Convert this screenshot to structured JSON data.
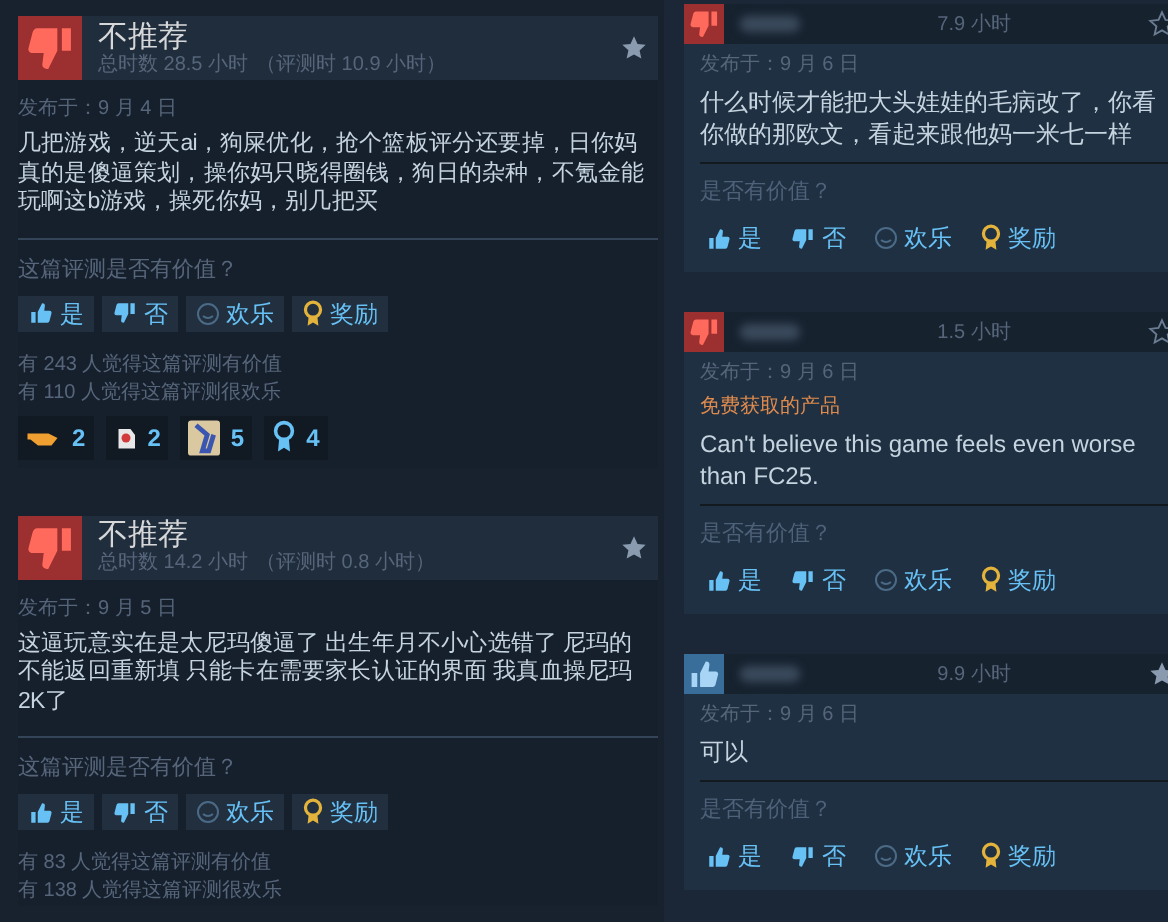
{
  "left_reviews": [
    {
      "recommended": false,
      "title": "不推荐",
      "hours": "总时数 28.5 小时",
      "review_hours": "（评测时 10.9 小时）",
      "date": "发布于：9 月 4 日",
      "text": "几把游戏，逆天ai，狗屎优化，抢个篮板评分还要掉，日你妈真的是傻逼策划，操你妈只晓得圈钱，狗日的杂种，不氪金能玩啊这b游戏，操死你妈，别几把买",
      "question": "这篇评测是否有价值？",
      "buttons": [
        {
          "kind": "yes",
          "label": "是"
        },
        {
          "kind": "no",
          "label": "否"
        },
        {
          "kind": "funny",
          "label": "欢乐"
        },
        {
          "kind": "award",
          "label": "奖励"
        }
      ],
      "helpful": "有 243 人觉得这篇评测有价值",
      "funny": "有 110 人觉得这篇评测很欢乐",
      "awards": [
        {
          "kind": "pointer",
          "count": "2"
        },
        {
          "kind": "tag",
          "count": "2"
        },
        {
          "kind": "figure",
          "count": "5"
        },
        {
          "kind": "ribbon",
          "count": "4"
        }
      ]
    },
    {
      "recommended": false,
      "title": "不推荐",
      "hours": "总时数 14.2 小时",
      "review_hours": "（评测时 0.8 小时）",
      "date": "发布于：9 月 5 日",
      "text": "这逼玩意实在是太尼玛傻逼了 出生年月不小心选错了 尼玛的不能返回重新填 只能卡在需要家长认证的界面 我真血操尼玛2K了",
      "question": "这篇评测是否有价值？",
      "buttons": [
        {
          "kind": "yes",
          "label": "是"
        },
        {
          "kind": "no",
          "label": "否"
        },
        {
          "kind": "funny",
          "label": "欢乐"
        },
        {
          "kind": "award",
          "label": "奖励"
        }
      ],
      "helpful": "有 83 人觉得这篇评测有价值",
      "funny": "有 138 人觉得这篇评测很欢乐"
    }
  ],
  "right_reviews": [
    {
      "recommended": false,
      "hours": "7.9 小时",
      "starred": false,
      "date": "发布于：9 月 6 日",
      "text": "什么时候才能把大头娃娃的毛病改了，你看你做的那欧文，看起来跟他妈一米七一样",
      "question": "是否有价值？",
      "buttons": [
        {
          "kind": "yes",
          "label": "是"
        },
        {
          "kind": "no",
          "label": "否"
        },
        {
          "kind": "funny",
          "label": "欢乐"
        },
        {
          "kind": "award",
          "label": "奖励"
        }
      ]
    },
    {
      "recommended": false,
      "hours": "1.5 小时",
      "starred": false,
      "date": "发布于：9 月 6 日",
      "free_label": "免费获取的产品",
      "text": "Can't believe this game feels even worse than FC25.",
      "question": "是否有价值？",
      "buttons": [
        {
          "kind": "yes",
          "label": "是"
        },
        {
          "kind": "no",
          "label": "否"
        },
        {
          "kind": "funny",
          "label": "欢乐"
        },
        {
          "kind": "award",
          "label": "奖励"
        }
      ]
    },
    {
      "recommended": true,
      "hours": "9.9 小时",
      "starred": true,
      "date": "发布于：9 月 6 日",
      "text": "可以",
      "question": "是否有价值？",
      "buttons": [
        {
          "kind": "yes",
          "label": "是"
        },
        {
          "kind": "no",
          "label": "否"
        },
        {
          "kind": "funny",
          "label": "欢乐"
        },
        {
          "kind": "award",
          "label": "奖励"
        }
      ]
    }
  ]
}
